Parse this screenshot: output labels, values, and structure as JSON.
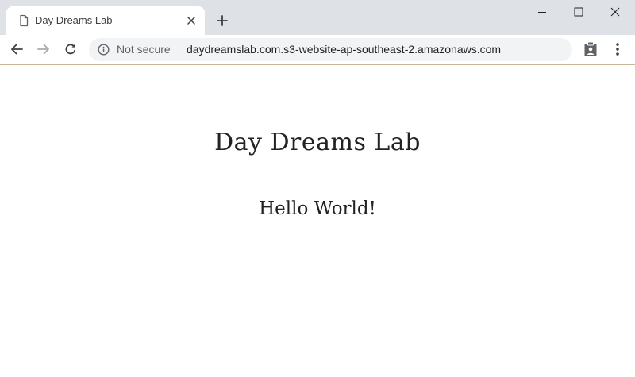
{
  "browser": {
    "tab": {
      "title": "Day Dreams Lab",
      "favicon": "page-icon"
    },
    "window_controls": [
      "minimize-icon",
      "maximize-icon",
      "close-icon"
    ],
    "toolbar": {
      "back": "back-arrow-icon",
      "forward": "forward-arrow-icon",
      "reload": "reload-icon",
      "security_label": "Not secure",
      "url": "daydreamslab.com.s3-website-ap-southeast-2.amazonaws.com",
      "extension": "clipboard-icon",
      "menu": "more-vert-icon"
    },
    "colors": {
      "tabstrip_bg": "#dee1e6",
      "omnibox_bg": "#f1f3f4",
      "page_text": "#222222"
    }
  },
  "page": {
    "heading": "Day Dreams Lab",
    "subheading": "Hello World!"
  }
}
